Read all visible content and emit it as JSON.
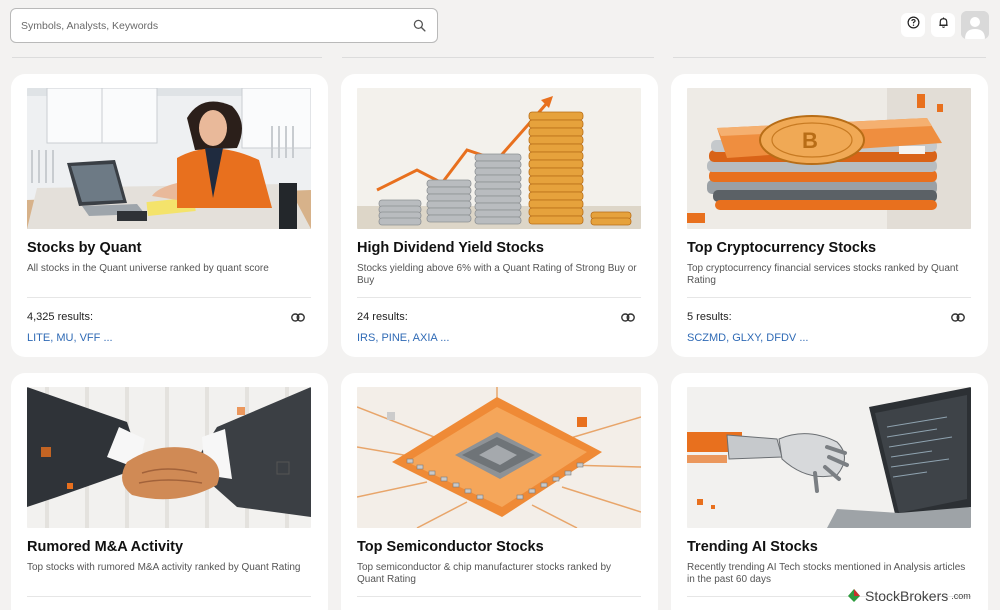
{
  "search": {
    "placeholder": "Symbols, Analysts, Keywords"
  },
  "header": {
    "icons": [
      "help-circle-icon",
      "bell-icon",
      "user-avatar-icon"
    ]
  },
  "cards": [
    {
      "title": "Stocks by Quant",
      "description": "All stocks in the Quant universe ranked by quant score",
      "results": "4,325 results:",
      "tickers": [
        "LITE",
        "MU",
        "VFF"
      ],
      "more": "..."
    },
    {
      "title": "High Dividend Yield Stocks",
      "description": "Stocks yielding above 6% with a Quant Rating of Strong Buy or Buy",
      "results": "24 results:",
      "tickers": [
        "IRS",
        "PINE",
        "AXIA"
      ],
      "more": "..."
    },
    {
      "title": "Top Cryptocurrency Stocks",
      "description": "Top cryptocurrency financial services stocks ranked by Quant Rating",
      "results": "5 results:",
      "tickers": [
        "SCZMD",
        "GLXY",
        "DFDV"
      ],
      "more": "..."
    },
    {
      "title": "Rumored M&A Activity",
      "description": "Top stocks with rumored M&A activity ranked by Quant Rating"
    },
    {
      "title": "Top Semiconductor Stocks",
      "description": "Top semiconductor & chip manufacturer stocks ranked by Quant Rating"
    },
    {
      "title": "Trending AI Stocks",
      "description": "Recently trending AI Tech stocks mentioned in Analysis articles in the past 60 days"
    }
  ],
  "watermark": {
    "brand": "StockBrokers",
    "suffix": ".com"
  },
  "colors": {
    "accent_orange": "#e8701e",
    "link_blue": "#2f6ab5",
    "background": "#f3f2f1"
  }
}
